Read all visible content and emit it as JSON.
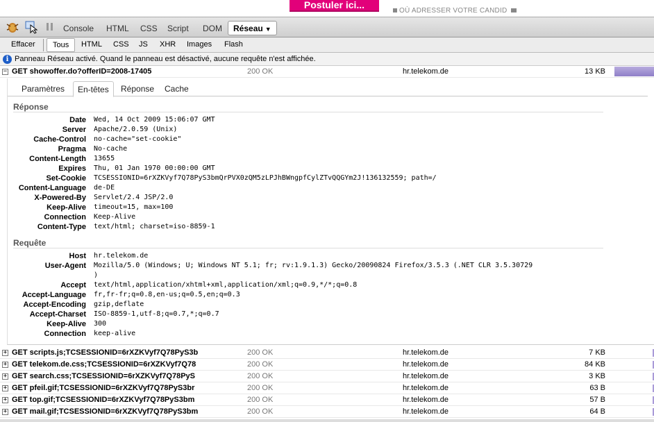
{
  "page": {
    "apply_button": "Postuler ici...",
    "where_text": "OÙ ADRESSER VOTRE CANDID"
  },
  "toolbar": {
    "tabs": [
      "Console",
      "HTML",
      "CSS",
      "Script",
      "DOM"
    ],
    "active_tab": "Réseau",
    "active_arrow": "▼"
  },
  "subtoolbar": {
    "clear": "Effacer",
    "filters": [
      "Tous",
      "HTML",
      "CSS",
      "JS",
      "XHR",
      "Images",
      "Flash"
    ]
  },
  "info": {
    "message": "Panneau Réseau activé. Quand le panneau est désactivé, aucune requête n'est affichée."
  },
  "main_request": {
    "toggle": "−",
    "url": "GET showoffer.do?offerID=2008-17405",
    "status": "200 OK",
    "domain": "hr.telekom.de",
    "size": "13 KB"
  },
  "detail_tabs": [
    "Paramètres",
    "En-têtes",
    "Réponse",
    "Cache"
  ],
  "response_section": {
    "title": "Réponse",
    "headers": [
      {
        "name": "Date",
        "value": "Wed, 14 Oct 2009 15:06:07 GMT"
      },
      {
        "name": "Server",
        "value": "Apache/2.0.59 (Unix)"
      },
      {
        "name": "Cache-Control",
        "value": "no-cache=\"set-cookie\""
      },
      {
        "name": "Pragma",
        "value": "No-cache"
      },
      {
        "name": "Content-Length",
        "value": "13655"
      },
      {
        "name": "Expires",
        "value": "Thu, 01 Jan 1970 00:00:00 GMT"
      },
      {
        "name": "Set-Cookie",
        "value": "TCSESSIONID=6rXZKVyf7Q78PyS3bmQrPVX0zQM5zLPJhBWngpfCylZTvQQGYm2J!136132559; path=/"
      },
      {
        "name": "Content-Language",
        "value": "de-DE"
      },
      {
        "name": "X-Powered-By",
        "value": "Servlet/2.4 JSP/2.0"
      },
      {
        "name": "Keep-Alive",
        "value": "timeout=15, max=100"
      },
      {
        "name": "Connection",
        "value": "Keep-Alive"
      },
      {
        "name": "Content-Type",
        "value": "text/html; charset=iso-8859-1"
      }
    ]
  },
  "request_section": {
    "title": "Requête",
    "headers": [
      {
        "name": "Host",
        "value": "hr.telekom.de"
      },
      {
        "name": "User-Agent",
        "value": "Mozilla/5.0 (Windows; U; Windows NT 5.1; fr; rv:1.9.1.3) Gecko/20090824 Firefox/3.5.3 (.NET CLR 3.5.30729",
        "value2": ")"
      },
      {
        "name": "Accept",
        "value": "text/html,application/xhtml+xml,application/xml;q=0.9,*/*;q=0.8"
      },
      {
        "name": "Accept-Language",
        "value": "fr,fr-fr;q=0.8,en-us;q=0.5,en;q=0.3"
      },
      {
        "name": "Accept-Encoding",
        "value": "gzip,deflate"
      },
      {
        "name": "Accept-Charset",
        "value": "ISO-8859-1,utf-8;q=0.7,*;q=0.7"
      },
      {
        "name": "Keep-Alive",
        "value": "300"
      },
      {
        "name": "Connection",
        "value": "keep-alive"
      }
    ]
  },
  "other_requests": [
    {
      "toggle": "+",
      "url": "GET scripts.js;TCSESSIONID=6rXZKVyf7Q78PyS3b",
      "status": "200 OK",
      "domain": "hr.telekom.de",
      "size": "7 KB"
    },
    {
      "toggle": "+",
      "url": "GET telekom.de.css;TCSESSIONID=6rXZKVyf7Q78",
      "status": "200 OK",
      "domain": "hr.telekom.de",
      "size": "84 KB"
    },
    {
      "toggle": "+",
      "url": "GET search.css;TCSESSIONID=6rXZKVyf7Q78PyS",
      "status": "200 OK",
      "domain": "hr.telekom.de",
      "size": "3 KB"
    },
    {
      "toggle": "+",
      "url": "GET pfeil.gif;TCSESSIONID=6rXZKVyf7Q78PyS3br",
      "status": "200 OK",
      "domain": "hr.telekom.de",
      "size": "63 B"
    },
    {
      "toggle": "+",
      "url": "GET top.gif;TCSESSIONID=6rXZKVyf7Q78PyS3bm",
      "status": "200 OK",
      "domain": "hr.telekom.de",
      "size": "57 B"
    },
    {
      "toggle": "+",
      "url": "GET mail.gif;TCSESSIONID=6rXZKVyf7Q78PyS3bm",
      "status": "200 OK",
      "domain": "hr.telekom.de",
      "size": "64 B"
    }
  ]
}
